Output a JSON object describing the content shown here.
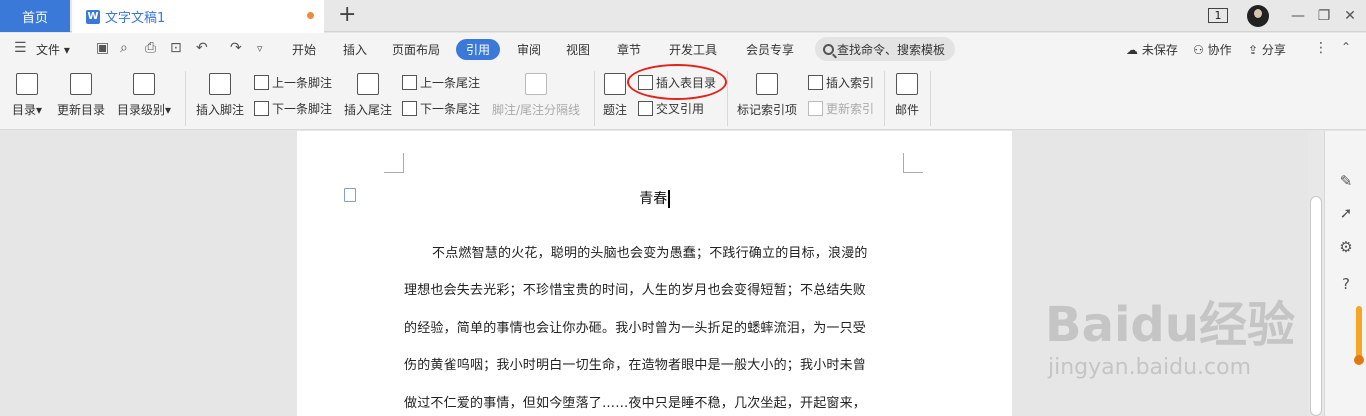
{
  "tabs": {
    "home": "首页",
    "document": "文字文稿1",
    "doc_icon_letter": "W",
    "add": "+"
  },
  "window": {
    "page_count_badge": "1",
    "minimize": "—",
    "restore": "❐",
    "close": "✕"
  },
  "menubar": {
    "file": "文件",
    "items": [
      "开始",
      "插入",
      "页面布局",
      "引用",
      "审阅",
      "视图",
      "章节",
      "开发工具",
      "会员专享"
    ],
    "active": "引用",
    "search_placeholder": "查找命令、搜索模板",
    "unsaved": "未保存",
    "collab": "协作",
    "share": "分享"
  },
  "ribbon": {
    "toc": "目录",
    "update_toc": "更新目录",
    "toc_level": "目录级别",
    "insert_footnote": "插入脚注",
    "prev_footnote": "上一条脚注",
    "next_footnote": "下一条脚注",
    "insert_endnote": "插入尾注",
    "prev_endnote": "上一条尾注",
    "next_endnote": "下一条尾注",
    "note_separator": "脚注/尾注分隔线",
    "caption": "题注",
    "insert_table_of_figures": "插入表目录",
    "cross_reference": "交叉引用",
    "mark_index_entry": "标记索引项",
    "insert_index": "插入索引",
    "update_index": "更新索引",
    "mail": "邮件"
  },
  "document": {
    "title": "青春",
    "lines": [
      "不点燃智慧的火花，聪明的头脑也会变为愚蠢；不践行确立的目标，浪漫的",
      "理想也会失去光彩；不珍惜宝贵的时间，人生的岁月也会变得短暂；不总结失败",
      "的经验，简单的事情也会让你办砸。我小时曾为一头折足的蟋蟀流泪，为一只受",
      "伤的黄雀呜咽；我小时明白一切生命，在造物者眼中是一般大小的；我小时未曾",
      "做过不仁爱的事情，但如今堕落了……夜中只是睡不稳，几次坐起，开起窗来，"
    ]
  },
  "watermark": {
    "brand": "Baidu经验",
    "url": "jingyan.baidu.com"
  },
  "colors": {
    "accent": "#3b79d8",
    "annotation_circle": "#e0241b",
    "unsaved_dot": "#f08a3c"
  }
}
